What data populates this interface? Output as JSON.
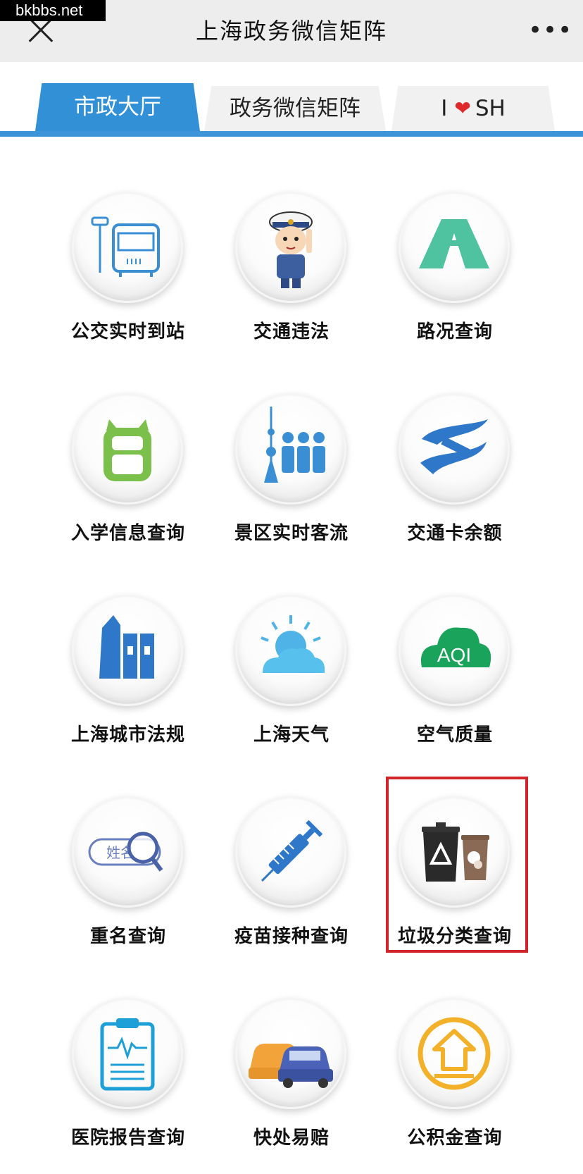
{
  "watermark": "bkbbs.net",
  "titlebar": {
    "title": "上海政务微信矩阵",
    "more": "•••"
  },
  "tabs": [
    {
      "label": "市政大厅"
    },
    {
      "label": "政务微信矩阵"
    },
    {
      "label_left": "I",
      "label_right": "SH"
    }
  ],
  "services": [
    {
      "label": "公交实时到站",
      "icon": "bus-stop-icon"
    },
    {
      "label": "交通违法",
      "icon": "traffic-police-icon"
    },
    {
      "label": "路况查询",
      "icon": "road-icon"
    },
    {
      "label": "入学信息查询",
      "icon": "backpack-icon"
    },
    {
      "label": "景区实时客流",
      "icon": "crowd-tower-icon"
    },
    {
      "label": "交通卡余额",
      "icon": "transport-card-icon"
    },
    {
      "label": "上海城市法规",
      "icon": "city-law-icon"
    },
    {
      "label": "上海天气",
      "icon": "weather-icon"
    },
    {
      "label": "空气质量",
      "icon": "aqi-cloud-icon",
      "badge": "AQI"
    },
    {
      "label": "重名查询",
      "icon": "name-search-icon",
      "badge": "姓名"
    },
    {
      "label": "疫苗接种查询",
      "icon": "syringe-icon"
    },
    {
      "label": "垃圾分类查询",
      "icon": "trash-bins-icon"
    },
    {
      "label": "医院报告查询",
      "icon": "medical-report-icon"
    },
    {
      "label": "快处易赔",
      "icon": "car-accident-icon"
    },
    {
      "label": "公积金查询",
      "icon": "housing-fund-icon"
    }
  ],
  "colors": {
    "accent": "#3290d6",
    "highlight": "#d0242a"
  }
}
